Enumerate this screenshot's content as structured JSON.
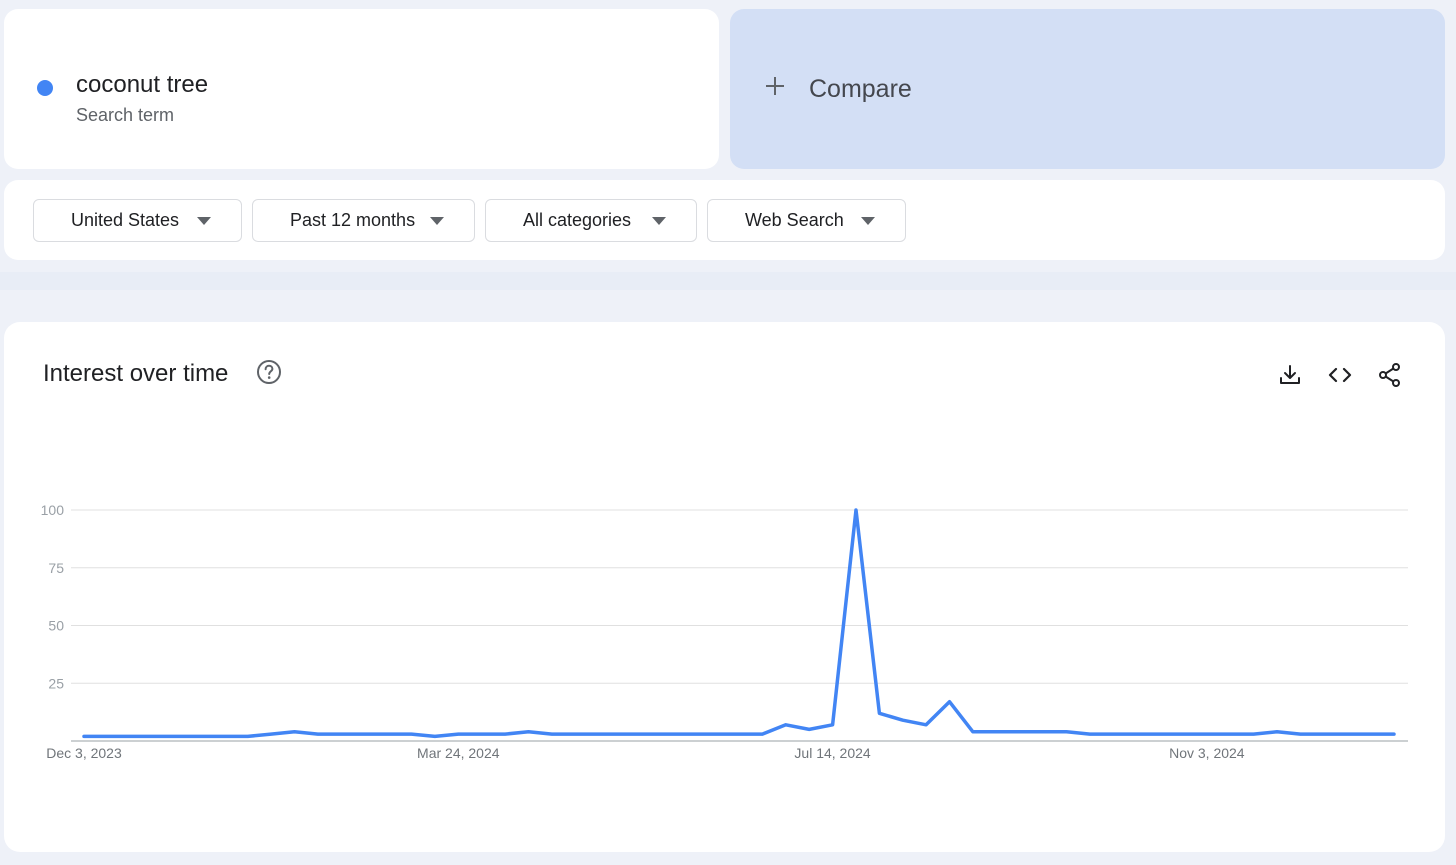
{
  "search_term": {
    "name": "coconut tree",
    "sublabel": "Search term",
    "color": "#4285f4"
  },
  "compare": {
    "label": "Compare",
    "icon": "plus-icon"
  },
  "filters": [
    {
      "label": "United States"
    },
    {
      "label": "Past 12 months"
    },
    {
      "label": "All categories"
    },
    {
      "label": "Web Search"
    }
  ],
  "panel": {
    "title": "Interest over time",
    "help_icon": "help-circle-icon",
    "actions": [
      "download-icon",
      "embed-code-icon",
      "share-icon"
    ]
  },
  "chart_data": {
    "type": "line",
    "ylim": [
      0,
      100
    ],
    "yticks": [
      "25",
      "50",
      "75",
      "100"
    ],
    "xtick_labels": [
      "Dec 3, 2023",
      "Mar 24, 2024",
      "Jul 14, 2024",
      "Nov 3, 2024"
    ],
    "grid": true,
    "line_color": "#4285f4",
    "series": [
      {
        "values": [
          2,
          2,
          2,
          2,
          2,
          2,
          2,
          2,
          3,
          4,
          3,
          3,
          3,
          3,
          3,
          2,
          3,
          3,
          3,
          4,
          3,
          3,
          3,
          3,
          3,
          3,
          3,
          3,
          3,
          3,
          7,
          5,
          7,
          100,
          12,
          9,
          7,
          17,
          4,
          4,
          4,
          4,
          4,
          3,
          3,
          3,
          3,
          3,
          3,
          3,
          3,
          4,
          3,
          3,
          3,
          3,
          3
        ]
      }
    ]
  }
}
